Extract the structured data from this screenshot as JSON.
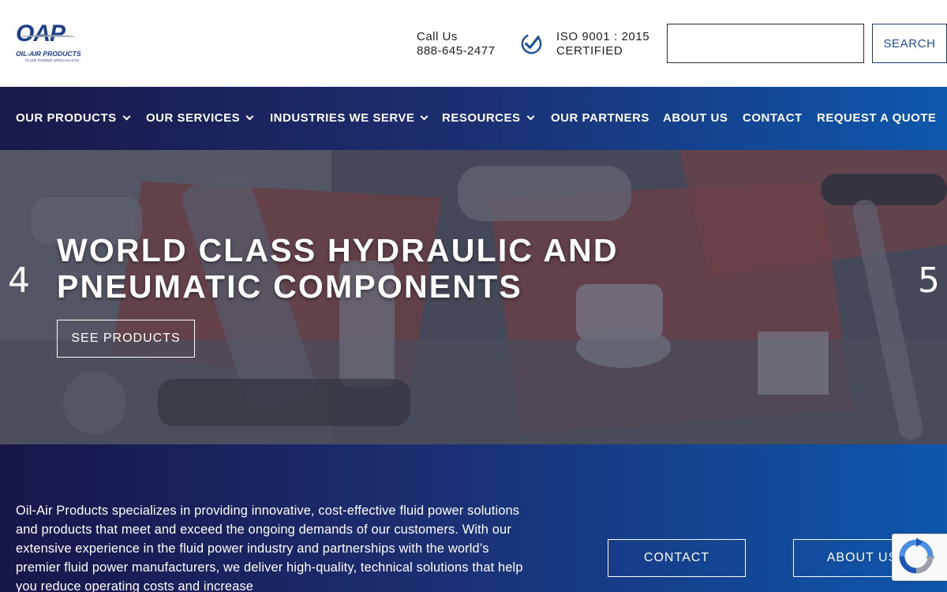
{
  "header": {
    "logo": {
      "mark": "OAP",
      "name": "OIL-AIR PRODUCTS",
      "tagline": "FLUID POWER SPECIALISTS"
    },
    "call_label": "Call Us",
    "phone": "888-645-2477",
    "iso_line1": "ISO 9001 : 2015",
    "iso_line2": "CERTIFIED",
    "search_value": "",
    "search_button": "SEARCH"
  },
  "nav": {
    "items": [
      {
        "label": "OUR PRODUCTS",
        "has_dropdown": true
      },
      {
        "label": "OUR SERVICES",
        "has_dropdown": true
      },
      {
        "label": "INDUSTRIES WE SERVE",
        "has_dropdown": true
      },
      {
        "label": "RESOURCES",
        "has_dropdown": true
      },
      {
        "label": "OUR PARTNERS",
        "has_dropdown": false
      },
      {
        "label": "ABOUT US",
        "has_dropdown": false
      },
      {
        "label": "CONTACT",
        "has_dropdown": false
      },
      {
        "label": "REQUEST A QUOTE",
        "has_dropdown": false
      }
    ]
  },
  "hero": {
    "title": "WORLD CLASS HYDRAULIC AND PNEUMATIC COMPONENTS",
    "button": "SEE PRODUCTS",
    "prev_arrow": "4",
    "next_arrow": "5"
  },
  "intro": {
    "text": "Oil-Air Products specializes in providing innovative, cost-effective fluid power solutions and products that meet and exceed the ongoing demands of our customers. With our extensive experience in the fluid power industry and partnerships with the world’s premier fluid power manufacturers, we deliver high-quality, technical solutions that help you reduce operating costs and increase",
    "contact_button": "CONTACT",
    "about_button": "ABOUT US"
  },
  "colors": {
    "brand_blue": "#1a3e8c",
    "nav_gradient_start": "#19194a",
    "nav_gradient_end": "#0e58ad"
  }
}
